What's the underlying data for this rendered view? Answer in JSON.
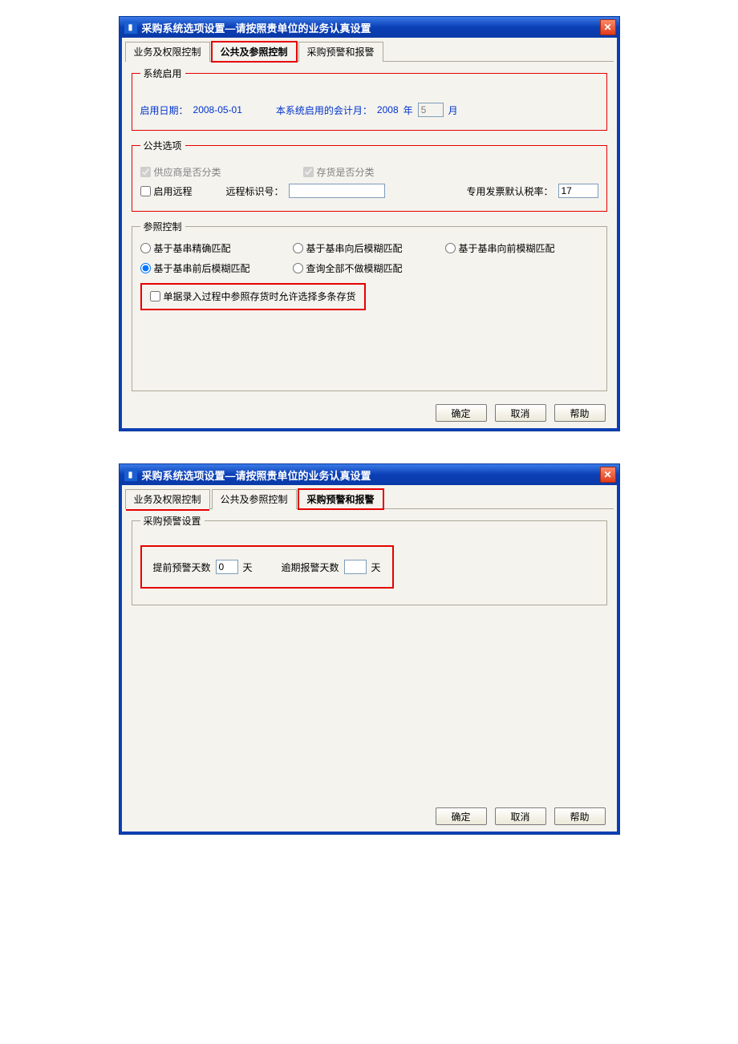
{
  "dialog1": {
    "title": "采购系统选项设置—请按照贵单位的业务认真设置",
    "tabs": {
      "t1": "业务及权限控制",
      "t2": "公共及参照控制",
      "t3": "采购预警和报警"
    },
    "sysEnable": {
      "legend": "系统启用",
      "startLabel": "启用日期：",
      "startDate": "2008-05-01",
      "monthLabel1": "本系统启用的会计月：",
      "year": "2008",
      "yearSuffix": "年",
      "monthValue": "5",
      "monthSuffix": "月"
    },
    "publicOpts": {
      "legend": "公共选项",
      "supplierClassify": "供应商是否分类",
      "stockClassify": "存货是否分类",
      "enableRemote": "启用远程",
      "remoteIdLabel": "远程标识号：",
      "remoteIdValue": "",
      "taxLabel": "专用发票默认税率：",
      "taxValue": "17"
    },
    "refCtrl": {
      "legend": "参照控制",
      "r1": "基于基串精确匹配",
      "r2": "基于基串向后模糊匹配",
      "r3": "基于基串向前模糊匹配",
      "r4": "基于基串前后模糊匹配",
      "r5": "查询全部不做模糊匹配",
      "multiStock": "单据录入过程中参照存货时允许选择多条存货"
    },
    "buttons": {
      "ok": "确定",
      "cancel": "取消",
      "help": "帮助"
    }
  },
  "dialog2": {
    "title": "采购系统选项设置—请按照贵单位的业务认真设置",
    "tabs": {
      "t1": "业务及权限控制",
      "t2": "公共及参照控制",
      "t3": "采购预警和报警"
    },
    "warning": {
      "legend": "采购预警设置",
      "preLabel": "提前预警天数",
      "preValue": "0",
      "daySuffix": "天",
      "overdueLabel": "逾期报警天数",
      "overdueValue": ""
    },
    "buttons": {
      "ok": "确定",
      "cancel": "取消",
      "help": "帮助"
    }
  },
  "icons": {
    "close": "✕",
    "app": "▮"
  }
}
